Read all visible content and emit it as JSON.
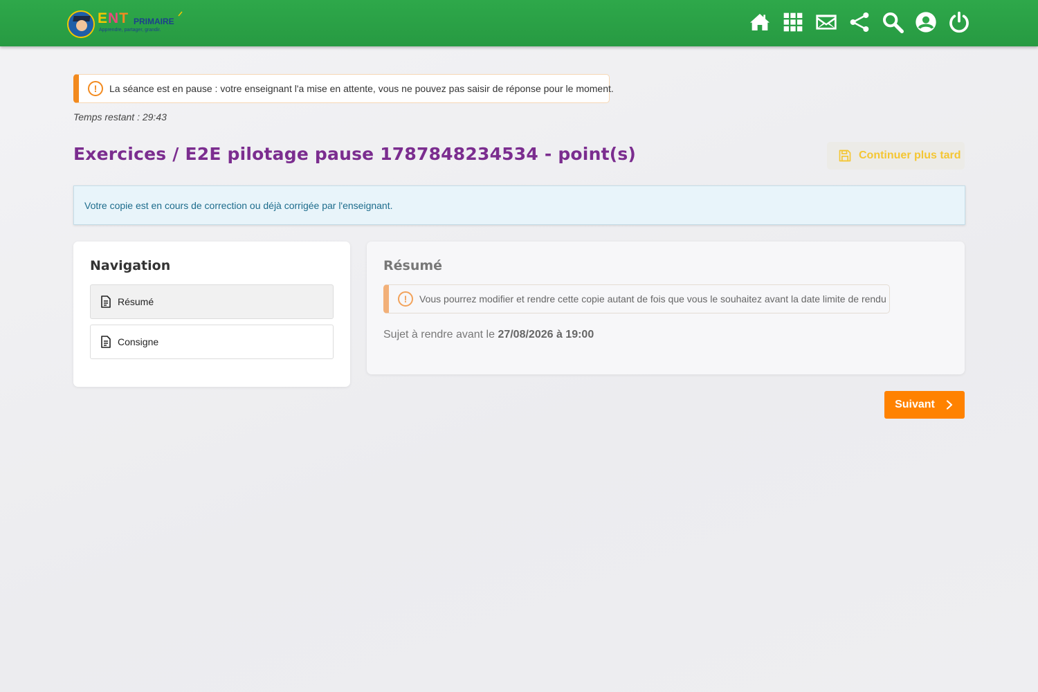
{
  "header": {
    "logo": {
      "ent": "ENT",
      "primaire": "PRIMAIRE",
      "tagline": "Apprendre, partager, grandir."
    },
    "icons": [
      "home-icon",
      "apps-grid-icon",
      "mail-icon",
      "share-icon",
      "search-icon",
      "account-icon",
      "power-icon"
    ]
  },
  "pause_alert": {
    "icon": "exclamation-circle-icon",
    "text": "La séance est en pause : votre enseignant l'a mise en attente, vous ne pouvez pas saisir de réponse pour le moment."
  },
  "timer": {
    "text": "Temps restant : 29:43"
  },
  "title": "Exercices / E2E pilotage pause 1787848234534 -  point(s)",
  "continue_later": {
    "label": "Continuer plus tard",
    "icon": "save-icon"
  },
  "info": {
    "text": "Votre copie est en cours de correction ou déjà corrigée par l'enseignant."
  },
  "navigation": {
    "title": "Navigation",
    "items": [
      {
        "label": "Résumé",
        "icon": "document-icon",
        "active": true
      },
      {
        "label": "Consigne",
        "icon": "document-icon",
        "active": false
      }
    ]
  },
  "summary": {
    "title": "Résumé",
    "alert": "Vous pourrez modifier et rendre cette copie autant de fois que vous le souhaitez avant la date limite de rendu",
    "due_prefix": "Sujet à rendre avant le ",
    "due_date": "27/08/2026 à 19:00"
  },
  "next": {
    "label": "Suivant",
    "icon": "chevron-right-icon"
  },
  "colors": {
    "header_green": "#2ea84a",
    "accent_orange": "#ff8200",
    "title_purple": "#7b2d8f",
    "later_yellow": "#f4c633"
  }
}
